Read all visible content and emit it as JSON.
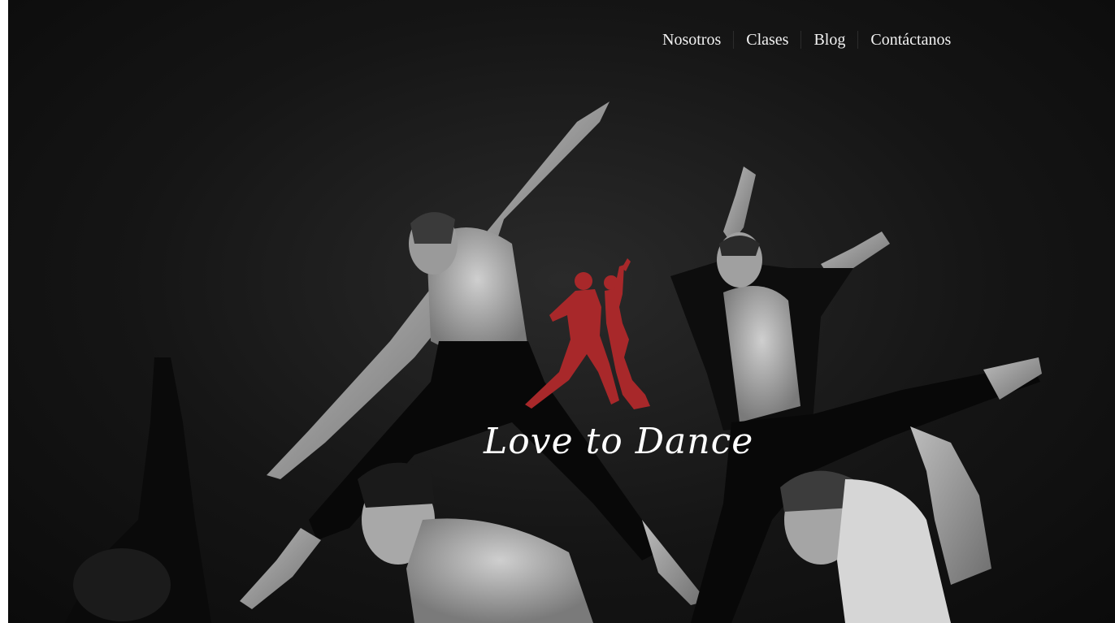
{
  "nav": {
    "items": [
      {
        "label": "Nosotros"
      },
      {
        "label": "Clases"
      },
      {
        "label": "Blog"
      },
      {
        "label": "Contáctanos"
      }
    ]
  },
  "logo": {
    "text": "Love to Dance",
    "color": "#a8282a",
    "icon": "dancing-couple-icon"
  },
  "hero": {
    "image": "dancers-photo"
  }
}
